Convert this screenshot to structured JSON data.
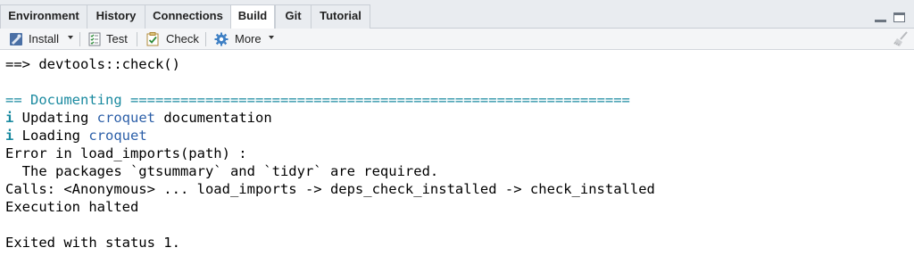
{
  "tabs": [
    {
      "label": "Environment"
    },
    {
      "label": "History"
    },
    {
      "label": "Connections"
    },
    {
      "label": "Build"
    },
    {
      "label": "Git"
    },
    {
      "label": "Tutorial"
    }
  ],
  "active_tab": "Build",
  "toolbar": {
    "install_label": "Install",
    "test_label": "Test",
    "check_label": "Check",
    "more_label": "More"
  },
  "console": {
    "cmd": "==> devtools::check()",
    "section_prefix": "== Documenting ",
    "section_rule": "============================================================",
    "info_glyph": "i",
    "updating_pre": " Updating ",
    "updating_pkg": "croquet",
    "updating_post": " documentation",
    "loading_pre": " Loading ",
    "loading_pkg": "croquet",
    "error_line": "Error in load_imports(path) :",
    "error_detail": "  The packages `gtsummary` and `tidyr` are required.",
    "calls_line": "Calls: <Anonymous> ... load_imports -> deps_check_installed -> check_installed",
    "halted_line": "Execution halted",
    "exit_line": "Exited with status 1."
  },
  "colors": {
    "section": "#1a8aa0",
    "package": "#2c5fa8"
  }
}
